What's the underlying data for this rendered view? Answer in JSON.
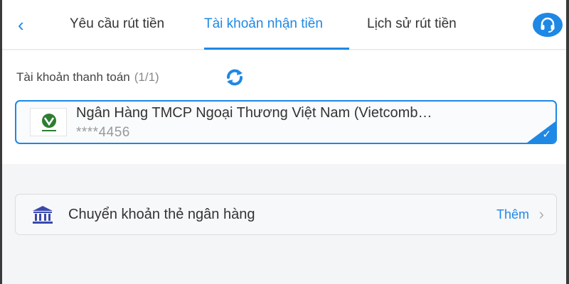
{
  "nav": {
    "back_icon": "chevron-left-icon",
    "tabs": [
      {
        "label": "Yêu cầu rút tiền"
      },
      {
        "label": "Tài khoản nhận tiền"
      },
      {
        "label": "Lịch sử rút tiền"
      }
    ],
    "active_tab": 1,
    "support_icon": "headset-icon"
  },
  "payment_section": {
    "label": "Tài khoản thanh toán",
    "count": "(1/1)",
    "refresh_icon": "refresh-icon",
    "account": {
      "bank_name": "Ngân Hàng TMCP Ngoại Thương Việt Nam (Vietcomb…",
      "number": "****4456",
      "logo_icon": "vietcombank-logo-icon",
      "selected_icon": "check-icon"
    }
  },
  "transfer_option": {
    "label": "Chuyển khoản thẻ ngân hàng",
    "action": "Thêm",
    "icon": "bank-icon",
    "chevron_icon": "chevron-right-icon"
  },
  "colors": {
    "accent": "#1e88e5",
    "text": "#333333",
    "muted": "#999999"
  }
}
